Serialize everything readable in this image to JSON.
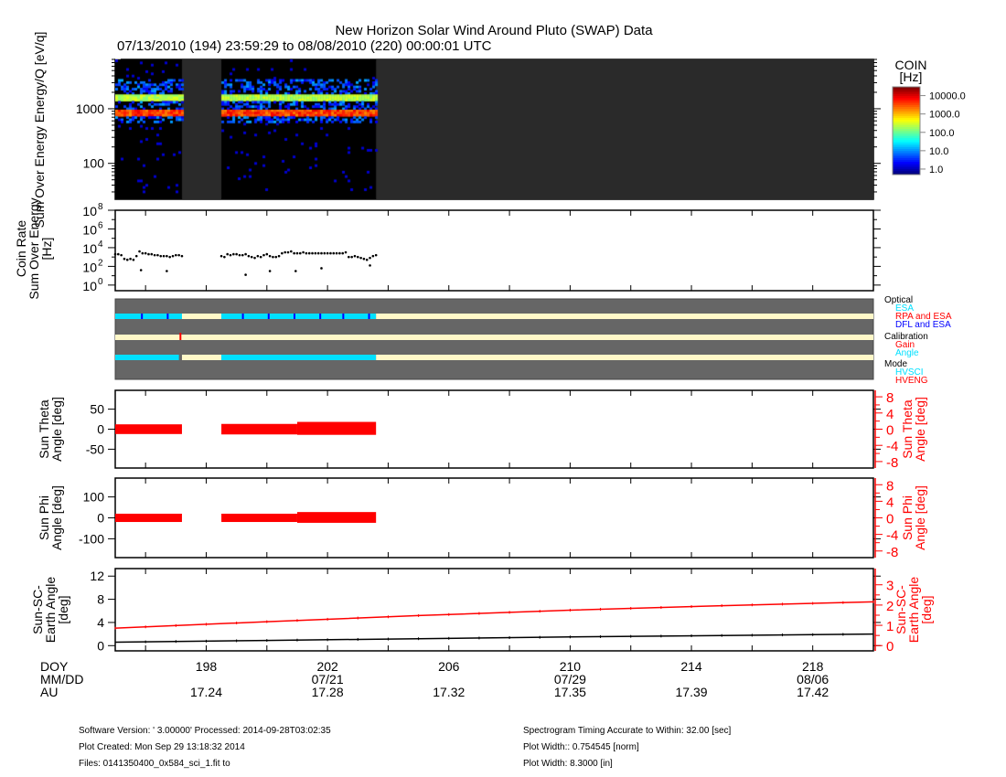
{
  "title": "New Horizon Solar Wind Around Pluto (SWAP) Data",
  "subtitle": "07/13/2010 (194) 23:59:29 to 08/08/2010 (220) 00:00:01 UTC",
  "colors": {
    "axis": "#000000",
    "right_axis": "#ff0000",
    "status_bg": "#666666",
    "cyan": "#00e0ff",
    "cream": "#fff8c8",
    "blue": "#0000ff",
    "red": "#ff0000",
    "nodata": "#2a2a2a"
  },
  "x_axis": {
    "doy_range": [
      195.0,
      220.0
    ],
    "rows": [
      {
        "label": "DOY",
        "ticks": [
          {
            "doy": 198,
            "text": "198"
          },
          {
            "doy": 202,
            "text": "202"
          },
          {
            "doy": 206,
            "text": "206"
          },
          {
            "doy": 210,
            "text": "210"
          },
          {
            "doy": 214,
            "text": "214"
          },
          {
            "doy": 218,
            "text": "218"
          }
        ]
      },
      {
        "label": "MM/DD",
        "ticks": [
          {
            "doy": 202,
            "text": "07/21"
          },
          {
            "doy": 210,
            "text": "07/29"
          },
          {
            "doy": 218,
            "text": "08/06"
          }
        ]
      },
      {
        "label": "AU",
        "ticks": [
          {
            "doy": 198,
            "text": "17.24"
          },
          {
            "doy": 202,
            "text": "17.28"
          },
          {
            "doy": 206,
            "text": "17.32"
          },
          {
            "doy": 210,
            "text": "17.35"
          },
          {
            "doy": 214,
            "text": "17.39"
          },
          {
            "doy": 218,
            "text": "17.42"
          }
        ]
      }
    ]
  },
  "chart_data": [
    {
      "type": "heatmap",
      "name": "spectrogram",
      "ylabel": "Sum Over Energy Energy/Q [eV/q]",
      "yscale": "log",
      "ylim": [
        22,
        8000
      ],
      "yticks": [
        {
          "v": 100,
          "text": "100"
        },
        {
          "v": 1000,
          "text": "1000"
        }
      ],
      "data_intervals": [
        [
          195.0,
          197.2
        ],
        [
          198.5,
          203.6
        ]
      ],
      "bands_eV": [
        {
          "center": 1600,
          "peak_hz": 300
        },
        {
          "center": 820,
          "peak_hz": 6000
        }
      ],
      "colorbar": {
        "title": "COIN",
        "unit": "[Hz]",
        "ticks": [
          {
            "v": 10000,
            "text": "10000.0"
          },
          {
            "v": 1000,
            "text": "1000.0"
          },
          {
            "v": 100,
            "text": "100.0"
          },
          {
            "v": 10,
            "text": "10.0"
          },
          {
            "v": 1,
            "text": "1.0"
          }
        ],
        "range": [
          0.5,
          30000
        ]
      }
    },
    {
      "type": "scatter",
      "name": "coin-rate",
      "ylabel_lines": [
        "Coin Rate",
        "Sum Over Energy",
        "[Hz]"
      ],
      "yscale": "log",
      "ylim_log10": [
        -0.6,
        8.0
      ],
      "yticks": [
        {
          "e": 0,
          "text": "10",
          "sup": "0"
        },
        {
          "e": 2,
          "text": "10",
          "sup": "2"
        },
        {
          "e": 4,
          "text": "10",
          "sup": "4"
        },
        {
          "e": 6,
          "text": "10",
          "sup": "6"
        },
        {
          "e": 8,
          "text": "10",
          "sup": "8"
        }
      ],
      "segments": [
        {
          "start": 195.0,
          "step": 0.1,
          "log10": [
            3.3,
            3.3,
            3.2,
            2.8,
            2.7,
            2.8,
            2.7,
            3.1,
            3.6,
            3.4,
            3.4,
            3.3,
            3.3,
            3.2,
            3.2,
            3.1,
            3.1,
            3.1,
            3.0,
            3.1,
            3.2,
            3.2,
            3.1
          ]
        },
        {
          "start": 198.5,
          "step": 0.1,
          "log10": [
            3.1,
            3.0,
            3.3,
            3.2,
            3.3,
            3.3,
            3.2,
            3.2,
            3.3,
            3.1,
            3.0,
            2.9,
            3.1,
            3.0,
            3.2,
            3.3,
            3.1,
            3.0,
            3.0,
            3.1,
            3.4,
            3.5,
            3.5,
            3.6,
            3.4,
            3.4,
            3.4,
            3.5,
            3.4,
            3.4,
            3.4,
            3.4,
            3.4,
            3.4,
            3.4,
            3.4,
            3.4,
            3.4,
            3.4,
            3.4,
            3.4,
            3.5,
            3.0,
            3.0,
            3.1,
            3.0,
            2.9,
            2.8,
            2.7,
            2.9,
            3.1,
            3.2
          ]
        }
      ],
      "outliers": [
        [
          195.85,
          1.6
        ],
        [
          196.7,
          1.5
        ],
        [
          199.3,
          1.1
        ],
        [
          200.1,
          1.5
        ],
        [
          200.95,
          1.5
        ],
        [
          201.8,
          1.8
        ],
        [
          203.4,
          2.1
        ]
      ]
    },
    {
      "type": "table",
      "name": "status-flags",
      "legend": [
        {
          "text": "Optical",
          "color": "#000000"
        },
        {
          "text": "ESA",
          "color": "#00e0ff"
        },
        {
          "text": "RPA and ESA",
          "color": "#ff0000"
        },
        {
          "text": "DFL and ESA",
          "color": "#0000ff"
        },
        {
          "text": "Calibration",
          "color": "#000000"
        },
        {
          "text": "Gain",
          "color": "#ff0000"
        },
        {
          "text": "Angle",
          "color": "#00e0ff"
        },
        {
          "text": "Mode",
          "color": "#000000"
        },
        {
          "text": "HVSCI",
          "color": "#00e0ff"
        },
        {
          "text": "HVENG",
          "color": "#ff0000"
        }
      ],
      "rows": [
        {
          "name": "optical",
          "segments": [
            [
              195.0,
              197.2,
              "cyan"
            ],
            [
              197.2,
              198.5,
              "cream"
            ],
            [
              198.5,
              203.6,
              "cyan"
            ],
            [
              203.6,
              220.0,
              "cream"
            ]
          ],
          "marks": [
            [
              195.88,
              "blue"
            ],
            [
              196.73,
              "blue"
            ],
            [
              199.21,
              "blue"
            ],
            [
              200.06,
              "blue"
            ],
            [
              200.91,
              "blue"
            ],
            [
              201.76,
              "blue"
            ],
            [
              202.52,
              "blue"
            ],
            [
              203.37,
              "blue"
            ]
          ]
        },
        {
          "name": "calibration",
          "segments": [
            [
              195.0,
              220.0,
              "cream"
            ]
          ],
          "marks": [
            [
              197.15,
              "red"
            ]
          ]
        },
        {
          "name": "mode",
          "segments": [
            [
              195.0,
              197.1,
              "cyan"
            ],
            [
              197.2,
              198.5,
              "cream"
            ],
            [
              198.5,
              203.6,
              "cyan"
            ],
            [
              203.6,
              220.0,
              "cream"
            ]
          ],
          "marks": []
        }
      ]
    },
    {
      "type": "area",
      "name": "sun-theta",
      "ylabel_lines": [
        "Sun Theta",
        "Angle [deg]"
      ],
      "ylim": [
        -97,
        97
      ],
      "yticks": [
        {
          "v": 50,
          "text": "50"
        },
        {
          "v": 0,
          "text": "0"
        },
        {
          "v": -50,
          "text": "-50"
        }
      ],
      "right_ylabel_lines": [
        "Sun Theta",
        "Angle [deg]"
      ],
      "right_ylim": [
        -9.6,
        9.6
      ],
      "right_yticks": [
        {
          "v": 8,
          "text": "8"
        },
        {
          "v": 4,
          "text": "4"
        },
        {
          "v": 0,
          "text": "0"
        },
        {
          "v": -4,
          "text": "-4"
        },
        {
          "v": -8,
          "text": "-8"
        }
      ],
      "series": [
        {
          "name": "theta",
          "axis": "right",
          "intervals": [
            [
              195.0,
              197.2,
              -1.2,
              1.2
            ],
            [
              198.5,
              201.0,
              -1.3,
              1.3
            ],
            [
              201.0,
              203.6,
              -1.4,
              1.8
            ]
          ]
        }
      ]
    },
    {
      "type": "area",
      "name": "sun-phi",
      "ylabel_lines": [
        "Sun Phi",
        "Angle [deg]"
      ],
      "ylim": [
        -190,
        190
      ],
      "yticks": [
        {
          "v": 100,
          "text": "100"
        },
        {
          "v": 0,
          "text": "0"
        },
        {
          "v": -100,
          "text": "-100"
        }
      ],
      "right_ylabel_lines": [
        "Sun Phi",
        "Angle [deg]"
      ],
      "right_ylim": [
        -9.6,
        9.6
      ],
      "right_yticks": [
        {
          "v": 8,
          "text": "8"
        },
        {
          "v": 4,
          "text": "4"
        },
        {
          "v": 0,
          "text": "0"
        },
        {
          "v": -4,
          "text": "-4"
        },
        {
          "v": -8,
          "text": "-8"
        }
      ],
      "series": [
        {
          "name": "phi",
          "axis": "right",
          "intervals": [
            [
              195.0,
              197.2,
              -1.0,
              1.0
            ],
            [
              198.5,
              201.0,
              -1.0,
              1.0
            ],
            [
              201.0,
              203.6,
              -1.2,
              1.4
            ]
          ]
        }
      ]
    },
    {
      "type": "line",
      "name": "sun-sc-earth-angle",
      "ylabel_lines": [
        "Sun-SC-",
        "Earth Angle",
        "[deg]"
      ],
      "ylim": [
        -0.9,
        13.3
      ],
      "yticks": [
        {
          "v": 0,
          "text": "0"
        },
        {
          "v": 4,
          "text": "4"
        },
        {
          "v": 8,
          "text": "8"
        },
        {
          "v": 12,
          "text": "12"
        }
      ],
      "right_ylabel_lines": [
        "Sun-SC-",
        "Earth Angle",
        "[deg]"
      ],
      "right_ylim": [
        -0.26,
        3.8
      ],
      "right_yticks": [
        {
          "v": 0,
          "text": "0"
        },
        {
          "v": 1,
          "text": "1"
        },
        {
          "v": 2,
          "text": "2"
        },
        {
          "v": 3,
          "text": "3"
        }
      ],
      "series": [
        {
          "name": "angle (left axis)",
          "axis": "left",
          "color": "#000000",
          "x": [
            195,
            200,
            205,
            210,
            215,
            220
          ],
          "y": [
            0.6,
            0.9,
            1.2,
            1.5,
            1.75,
            2.0
          ]
        },
        {
          "name": "angle (right axis)",
          "axis": "right",
          "color": "#ff0000",
          "x": [
            195,
            200,
            205,
            210,
            215,
            220
          ],
          "y": [
            0.86,
            1.18,
            1.48,
            1.75,
            1.97,
            2.16
          ]
        }
      ]
    }
  ],
  "footer": {
    "left": [
      "Software Version:  ' 3.00000'  Processed: 2014-09-28T03:02:35",
      "Plot Created: Mon Sep 29 13:18:32 2014",
      "Files: 0141350400_0x584_sci_1.fit to"
    ],
    "right": [
      "Spectrogram Timing Accurate to Within: 32.00 [sec]",
      "Plot Width:: 0.754545 [norm]",
      "Plot Width: 8.3000 [in]"
    ]
  }
}
